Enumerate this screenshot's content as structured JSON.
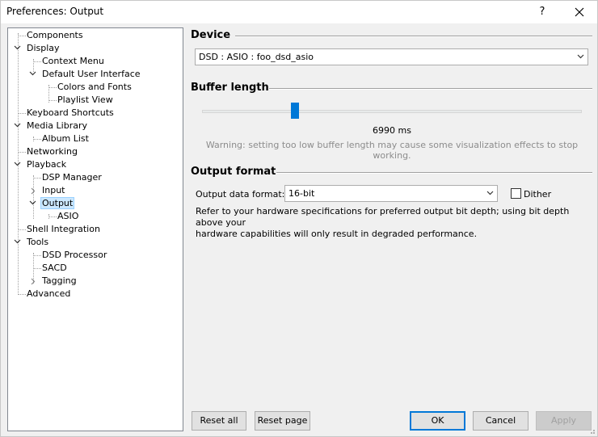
{
  "window": {
    "title": "Preferences: Output",
    "help_label": "?"
  },
  "tree": {
    "components": "Components",
    "display": "Display",
    "context_menu": "Context Menu",
    "default_ui": "Default User Interface",
    "colors_fonts": "Colors and Fonts",
    "playlist_view": "Playlist View",
    "keyboard_shortcuts": "Keyboard Shortcuts",
    "media_library": "Media Library",
    "album_list": "Album List",
    "networking": "Networking",
    "playback": "Playback",
    "dsp_manager": "DSP Manager",
    "input": "Input",
    "output": "Output",
    "asio": "ASIO",
    "shell_integration": "Shell Integration",
    "tools": "Tools",
    "dsd_processor": "DSD Processor",
    "sacd": "SACD",
    "tagging": "Tagging",
    "advanced": "Advanced"
  },
  "device": {
    "heading": "Device",
    "selected": "DSD : ASIO : foo_dsd_asio"
  },
  "buffer": {
    "heading": "Buffer length",
    "value_text": "6990 ms",
    "slider_fraction": 0.24,
    "warning": "Warning: setting too low buffer length may cause some visualization effects to stop working."
  },
  "output_format": {
    "heading": "Output format",
    "data_format_label": "Output data format:",
    "data_format_value": "16-bit",
    "dither_label": "Dither",
    "dither_checked": false,
    "info_line1": "Refer to your hardware specifications for preferred output bit depth; using bit depth above your",
    "info_line2": "hardware capabilities will only result in degraded performance."
  },
  "buttons": {
    "reset_all": "Reset all",
    "reset_page": "Reset page",
    "ok": "OK",
    "cancel": "Cancel",
    "apply": "Apply"
  },
  "colors": {
    "accent": "#0078d7",
    "selection": "#cce8ff"
  }
}
